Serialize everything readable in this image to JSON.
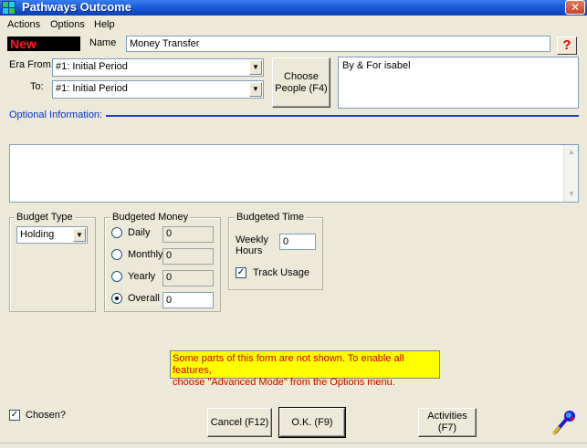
{
  "window": {
    "title": "Pathways Outcome",
    "close": "✕"
  },
  "menu": {
    "items": [
      "Actions",
      "Options",
      "Help"
    ]
  },
  "status_badge": "New",
  "name": {
    "label": "Name",
    "value": "Money Transfer"
  },
  "era_from": {
    "label": "Era From:",
    "value": "#1: Initial Period"
  },
  "era_to": {
    "label": "To:",
    "value": "#1: Initial Period"
  },
  "choose_people": {
    "line1": "Choose",
    "line2": "People (F4)"
  },
  "people_text": "By & For isabel",
  "optional_info": {
    "label": "Optional Information:",
    "value": ""
  },
  "budget_type": {
    "title": "Budget Type",
    "value": "Holding"
  },
  "budgeted_money": {
    "title": "Budgeted Money",
    "options": [
      {
        "label": "Daily",
        "value": "0",
        "selected": false
      },
      {
        "label": "Monthly",
        "value": "0",
        "selected": false
      },
      {
        "label": "Yearly",
        "value": "0",
        "selected": false
      },
      {
        "label": "Overall",
        "value": "0",
        "selected": true
      }
    ]
  },
  "budgeted_time": {
    "title": "Budgeted Time",
    "weekly_label_1": "Weekly",
    "weekly_label_2": "Hours",
    "weekly_value": "0",
    "track_usage_label": "Track Usage",
    "track_usage_checked": true
  },
  "warning": {
    "line1": "Some parts of this form are not shown.  To enable all features,",
    "line2": "choose \"Advanced Mode\" from the Options menu."
  },
  "chosen": {
    "label": "Chosen?",
    "checked": true
  },
  "buttons": {
    "cancel": "Cancel (F12)",
    "ok": "O.K. (F9)",
    "activities_1": "Activities",
    "activities_2": "(F7)"
  },
  "help_glyph": "?",
  "icons": {
    "app": "app-grid-icon",
    "help": "help-icon",
    "tool": "magnifier-tool-icon"
  }
}
